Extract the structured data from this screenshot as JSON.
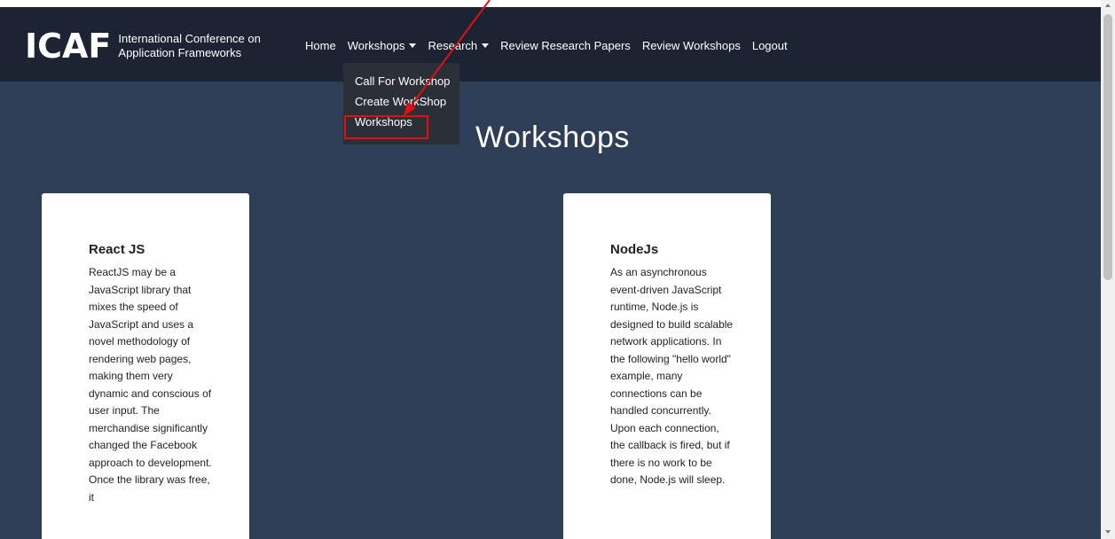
{
  "brand": {
    "mark": "ICAF",
    "subtitle": "International Conference on Application Frameworks"
  },
  "nav": {
    "home": "Home",
    "workshops": "Workshops",
    "research": "Research",
    "review_papers": "Review Research Papers",
    "review_workshops": "Review Workshops",
    "logout": "Logout"
  },
  "dropdown": {
    "items": [
      "Call For Workshop",
      "Create WorkShop",
      "Workshops"
    ],
    "highlighted_item": "Workshops"
  },
  "page": {
    "title": "Workshops"
  },
  "cards": [
    {
      "title": "React JS",
      "text": "ReactJS may be a JavaScript library that mixes the speed of JavaScript and uses a novel methodology of rendering web pages, making them very dynamic and conscious of user input. The merchandise significantly changed the Facebook approach to development. Once the library was free, it"
    },
    {
      "title": "NodeJs",
      "text": "As an asynchronous event-driven JavaScript runtime, Node.js is designed to build scalable network applications. In the following \"hello world\" example, many connections can be handled concurrently. Upon each connection, the callback is fired, but if there is no work to be done, Node.js will sleep."
    }
  ],
  "colors": {
    "navbar_bg": "#1c2333",
    "main_bg": "#2d3e56",
    "dropdown_bg": "#2a2f38",
    "annotation_red": "#e01010"
  },
  "icons": {
    "nav_caret": "caret-down-icon",
    "annotation": "red-arrow-icon"
  }
}
